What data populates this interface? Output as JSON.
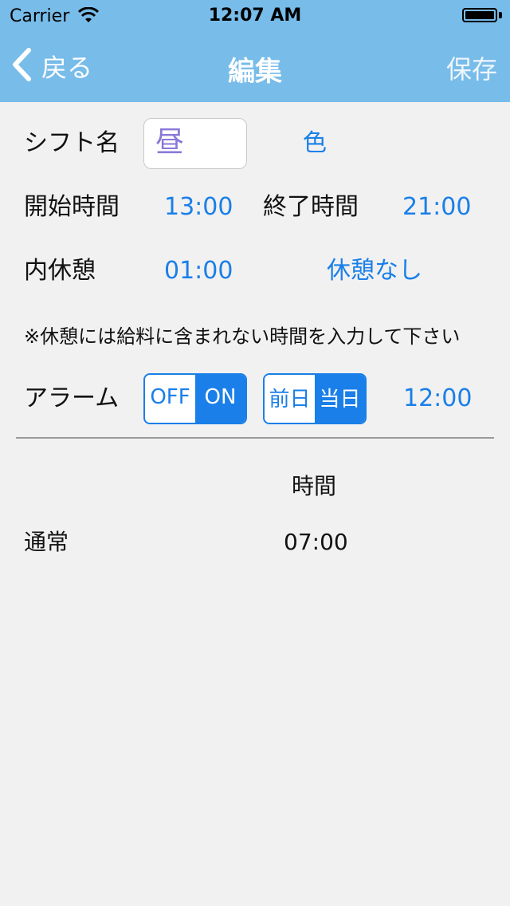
{
  "status_bar": {
    "carrier": "Carrier",
    "time": "12:07 AM",
    "battery_level": 1.0
  },
  "nav": {
    "back_label": "戻る",
    "title": "編集",
    "save_label": "保存"
  },
  "form": {
    "shift_name_label": "シフト名",
    "shift_name_value": "昼",
    "color_label": "色",
    "start_label": "開始時間",
    "start_value": "13:00",
    "end_label": "終了時間",
    "end_value": "21:00",
    "break_label": "内休憩",
    "break_value": "01:00",
    "no_break_label": "休憩なし",
    "note": "※休憩には給料に含まれない時間を入力して下さい",
    "alarm_label": "アラーム",
    "alarm_toggle": {
      "off": "OFF",
      "on": "ON",
      "selected": "ON"
    },
    "alarm_day": {
      "prev": "前日",
      "same": "当日",
      "selected": "当日"
    },
    "alarm_time": "12:00"
  },
  "summary": {
    "header": "時間",
    "rows": [
      {
        "label": "通常",
        "value": "07:00"
      }
    ]
  },
  "colors": {
    "nav_bg": "#78bce9",
    "accent": "#1a7fe8",
    "background": "#f1f1f1"
  }
}
